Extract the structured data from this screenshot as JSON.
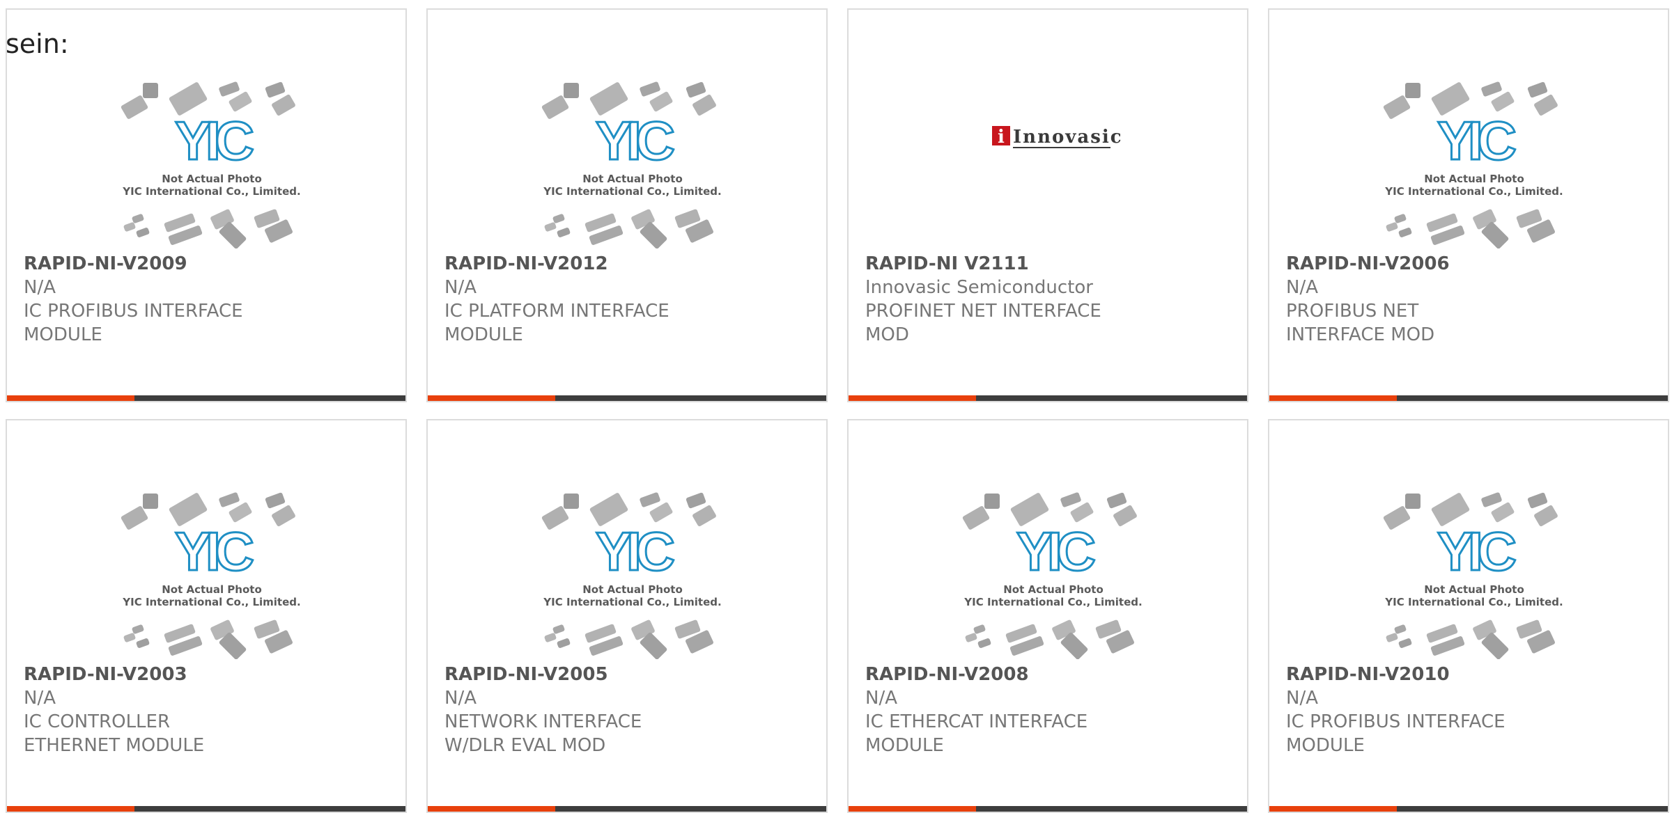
{
  "header": {
    "fragment": "sein:"
  },
  "placeholder_caption": [
    "Not Actual Photo",
    "YIC International Co., Limited."
  ],
  "placeholder_logo": "YIC",
  "brand_logo_text": "Innovasic",
  "colors": {
    "accent": "#e8400c",
    "bar": "#3d3d3d",
    "text": "#666666",
    "yic_blue": "#1f8fc4"
  },
  "products": [
    {
      "part": "RAPID-NI-V2009",
      "maker": "N/A",
      "desc": "IC PROFIBUS INTERFACE MODULE",
      "image": "yic-placeholder"
    },
    {
      "part": "RAPID-NI-V2012",
      "maker": "N/A",
      "desc": "IC PLATFORM INTERFACE MODULE",
      "image": "yic-placeholder"
    },
    {
      "part": "RAPID-NI V2111",
      "maker": "Innovasic Semiconductor",
      "desc": "PROFINET NET INTERFACE MOD",
      "image": "innovasic-logo"
    },
    {
      "part": "RAPID-NI-V2006",
      "maker": "N/A",
      "desc": "PROFIBUS NET INTERFACE MOD",
      "image": "yic-placeholder"
    },
    {
      "part": "RAPID-NI-V2003",
      "maker": "N/A",
      "desc": "IC CONTROLLER ETHERNET MODULE",
      "image": "yic-placeholder"
    },
    {
      "part": "RAPID-NI-V2005",
      "maker": "N/A",
      "desc": "NETWORK INTERFACE W/DLR EVAL MOD",
      "image": "yic-placeholder"
    },
    {
      "part": "RAPID-NI-V2008",
      "maker": "N/A",
      "desc": "IC ETHERCAT INTERFACE MODULE",
      "image": "yic-placeholder"
    },
    {
      "part": "RAPID-NI-V2010",
      "maker": "N/A",
      "desc": "IC PROFIBUS INTERFACE MODULE",
      "image": "yic-placeholder"
    }
  ]
}
